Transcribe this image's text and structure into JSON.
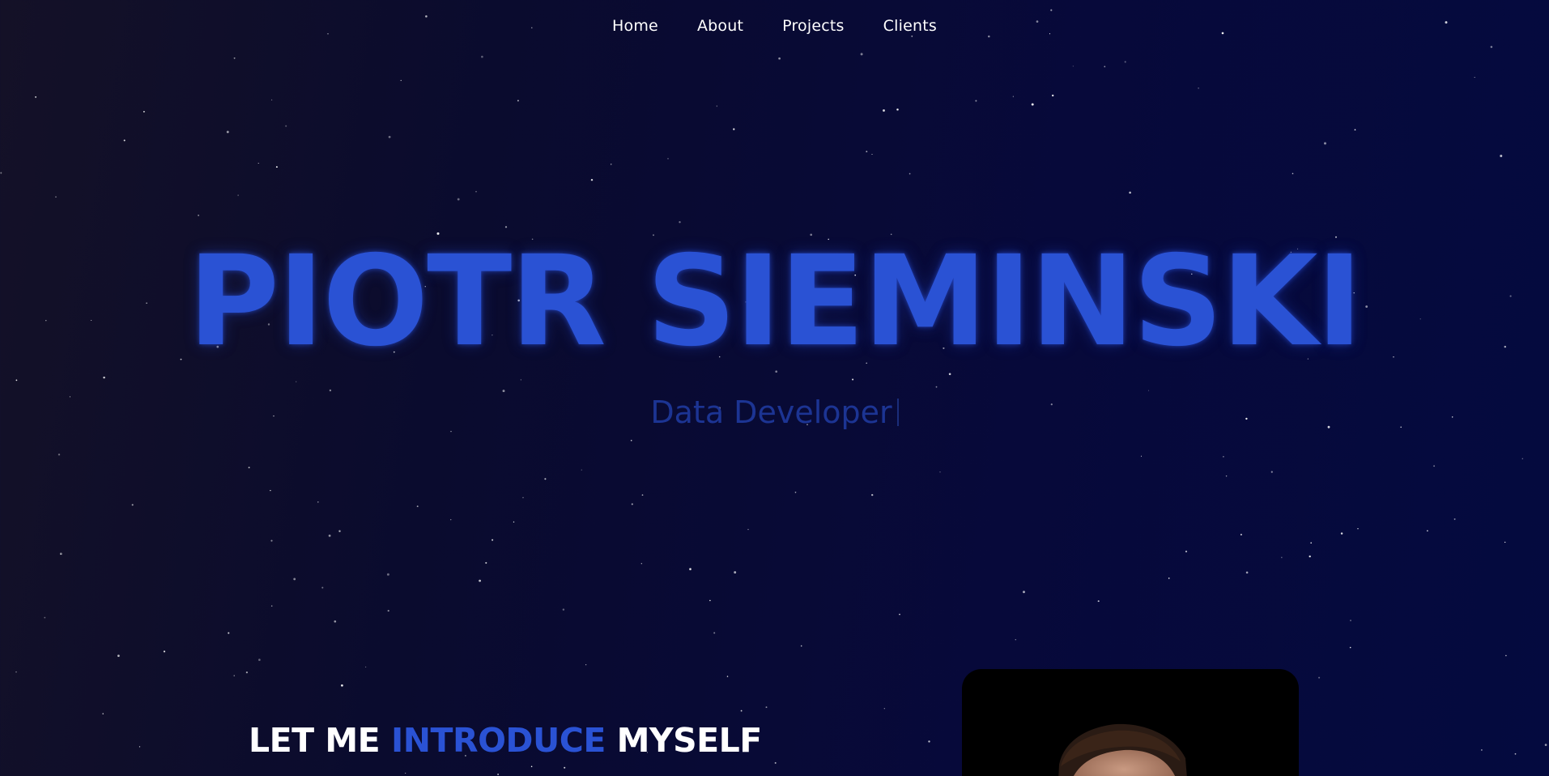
{
  "nav": {
    "items": [
      {
        "label": "Home"
      },
      {
        "label": "About"
      },
      {
        "label": "Projects"
      },
      {
        "label": "Clients"
      }
    ]
  },
  "hero": {
    "name": "PIOTR SIEMINSKI",
    "role": "Data Developer"
  },
  "intro": {
    "heading_part1": "LET ME ",
    "heading_accent": "INTRODUCE",
    "heading_part2": " MYSELF"
  },
  "colors": {
    "accent": "#2a52d4",
    "role_text": "#1c3493",
    "background_dark": "#0a0b2e"
  }
}
